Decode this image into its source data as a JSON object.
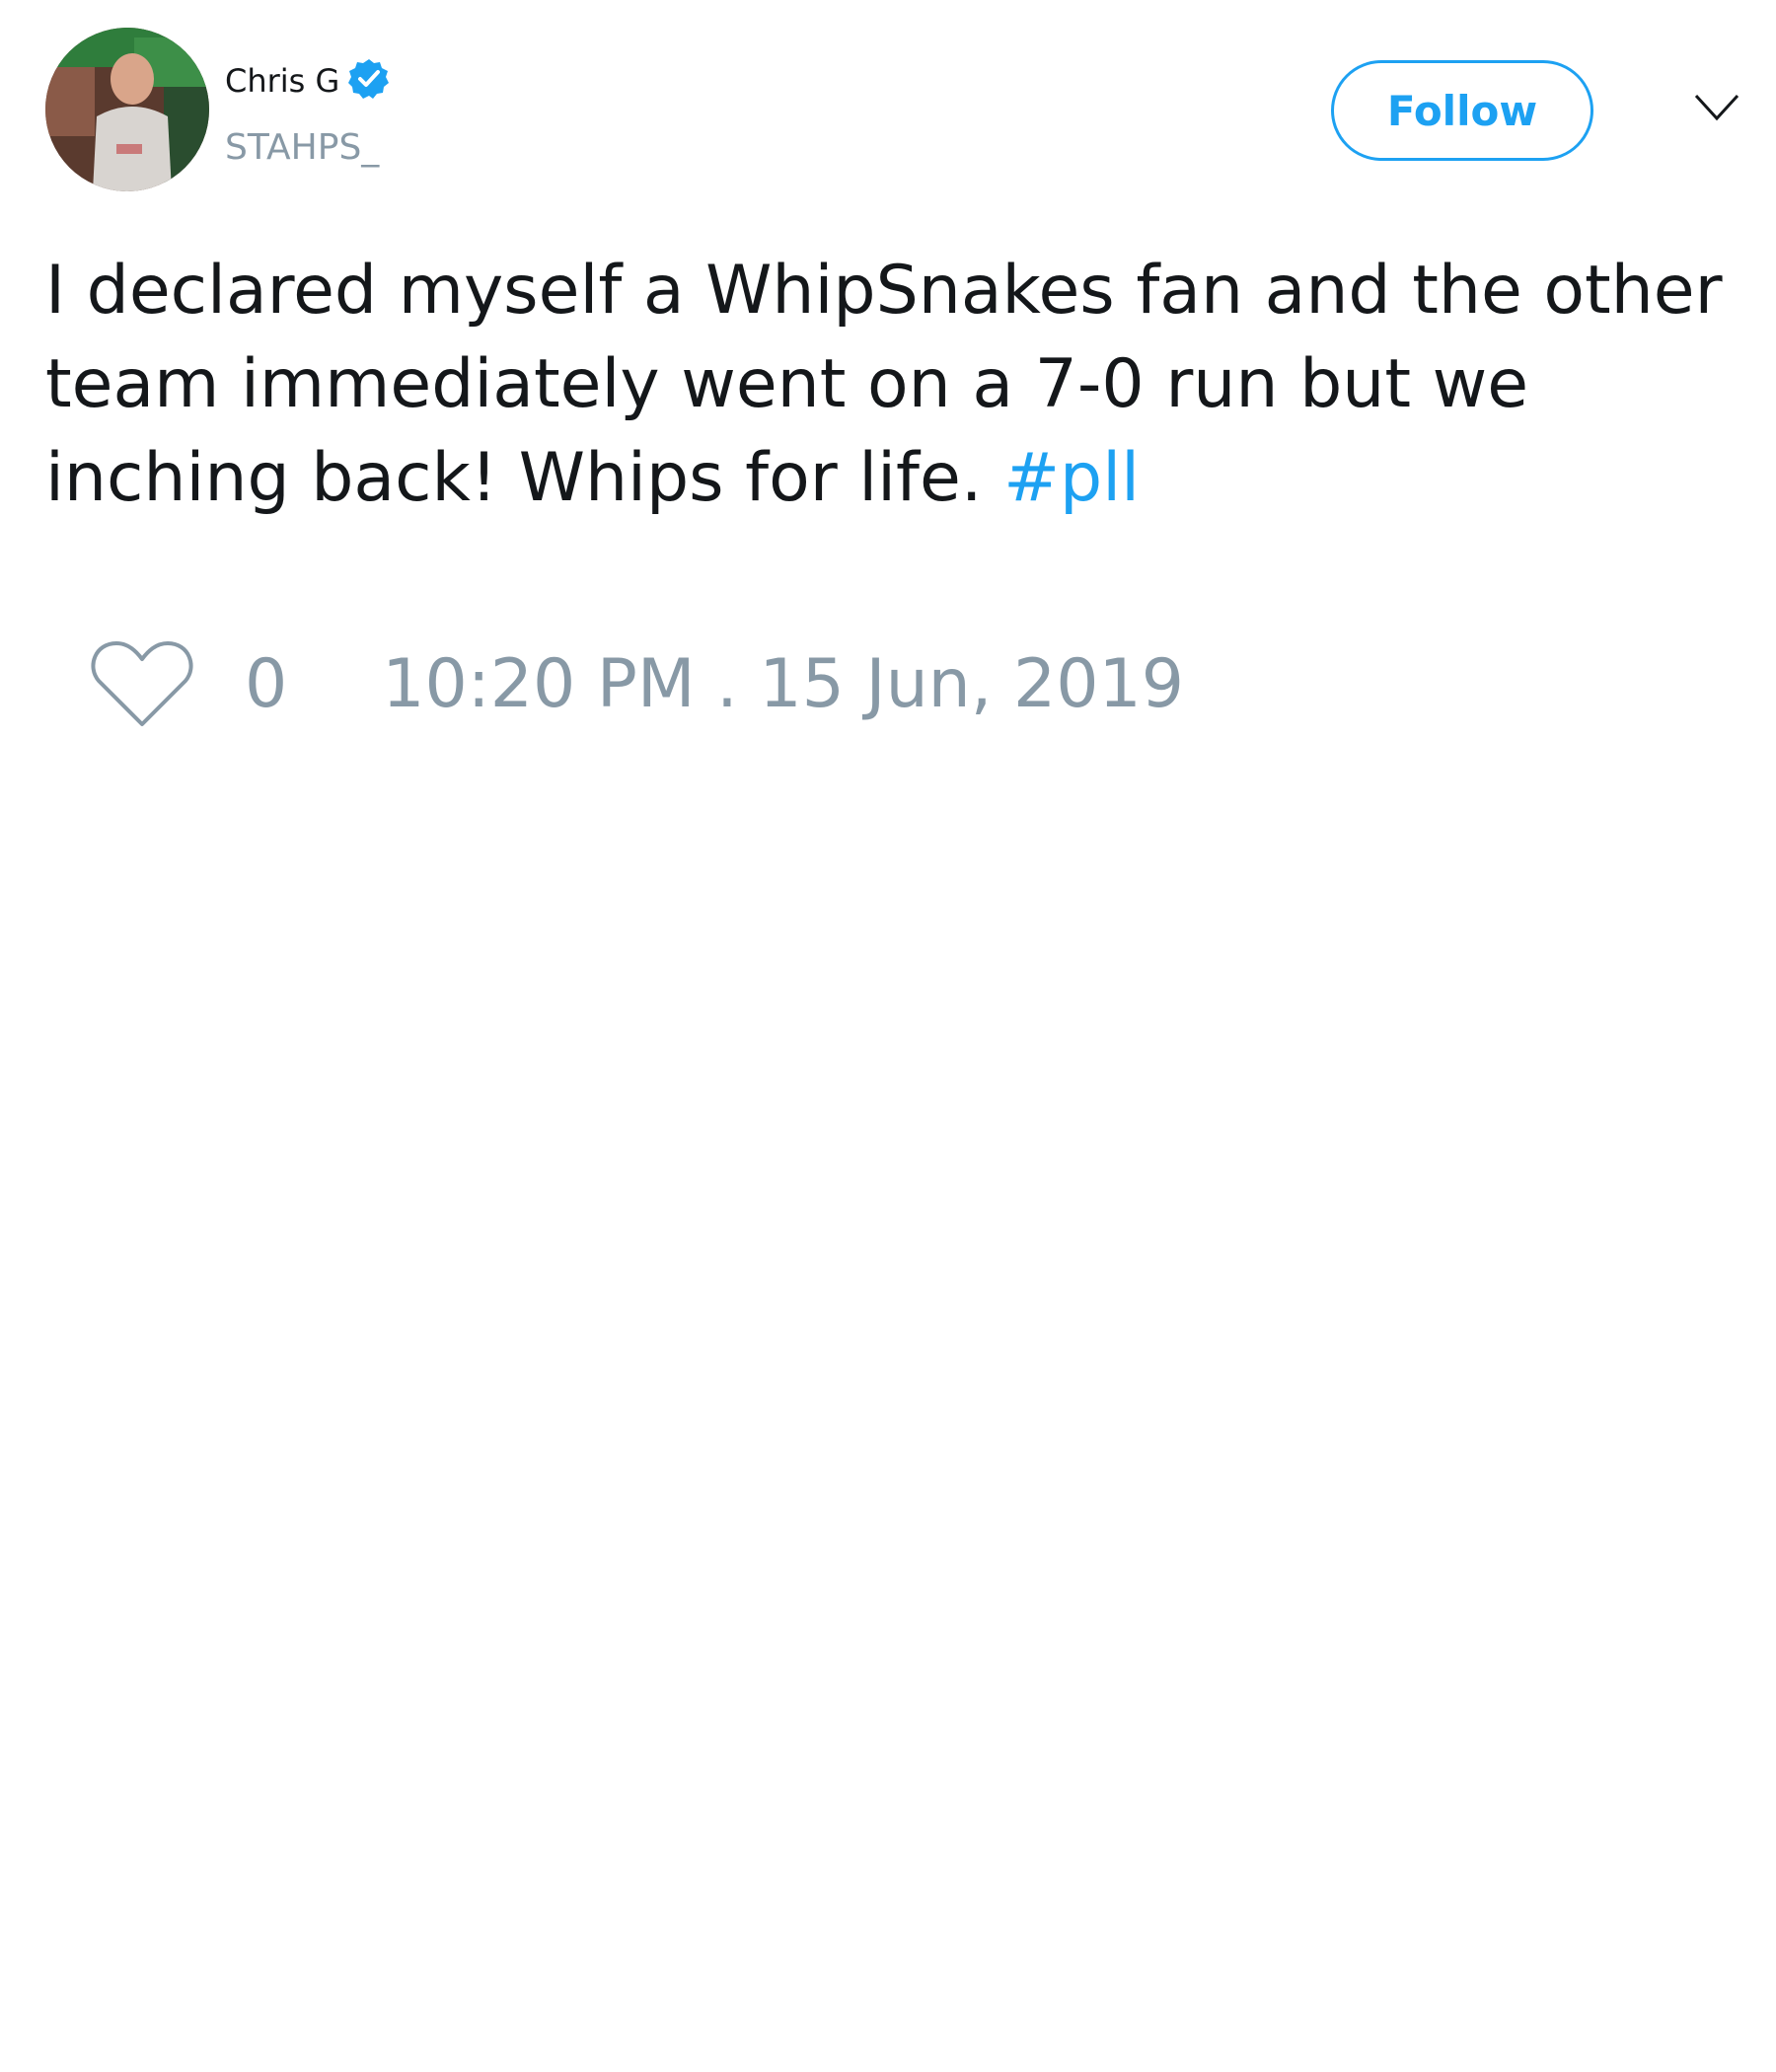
{
  "user": {
    "display_name": "Chris G",
    "handle": "STAHPS_",
    "verified": true
  },
  "actions": {
    "follow_label": "Follow"
  },
  "tweet": {
    "text": "I declared myself a WhipSnakes fan and the other\nteam immediately went on a 7-0 run but we\ninching back! Whips for life. ",
    "hashtag": "#pll"
  },
  "footer": {
    "like_count": "0",
    "timestamp": "10:20 PM . 15 Jun, 2019"
  },
  "icons": {
    "verified": "verified-badge-icon",
    "caret": "chevron-down-icon",
    "like": "heart-icon"
  },
  "colors": {
    "accent": "#1da1f2",
    "text": "#14171a",
    "muted": "#8899a6"
  }
}
